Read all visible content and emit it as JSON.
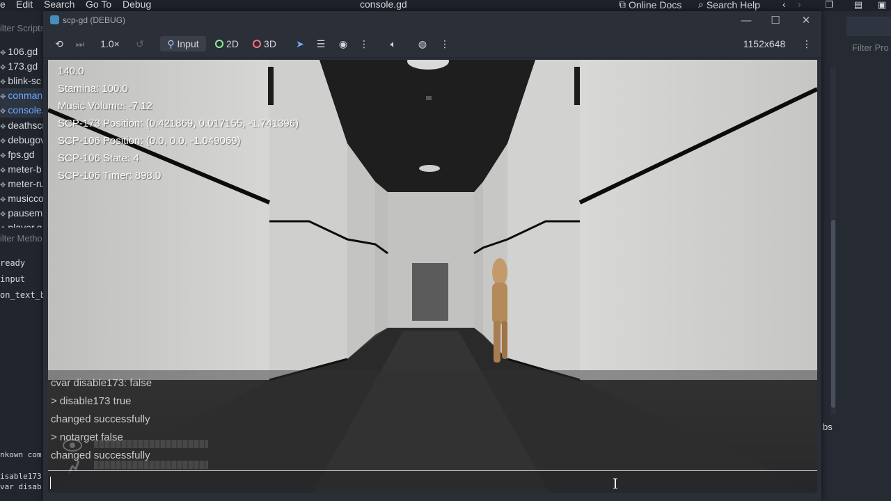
{
  "editor": {
    "menu": [
      "e",
      "Edit",
      "Search",
      "Go To",
      "Debug"
    ],
    "file_title": "console.gd",
    "online_docs": "Online Docs",
    "search_help": "Search Help",
    "filter_scripts": "ilter Scripts",
    "scripts": [
      "106.gd",
      "173.gd",
      "blink-sc",
      "conman.",
      "console.",
      "deathscr",
      "debugov",
      "fps.gd",
      "meter-b",
      "meter-ru",
      "musicco",
      "pauseme",
      "player.g"
    ],
    "filter_methods": "ilter Metho",
    "methods": [
      "ready",
      "input",
      "on_text_b"
    ],
    "output_lines": [
      "nkown com",
      "isable173",
      "var disab"
    ],
    "right_filter": "Filter Pro",
    "right_tab": "bs"
  },
  "window": {
    "title": "scp-gd (DEBUG)",
    "minimize": "—",
    "maximize": "☐",
    "close": "✕"
  },
  "toolbar": {
    "speed": "1.0×",
    "input": "Input",
    "mode_2d": "2D",
    "mode_3d": "3D",
    "resolution": "1152x648"
  },
  "hud": {
    "line1": "140.0",
    "stamina": "Stamina: 100.0",
    "music_volume": "Music Volume: -7.12",
    "scp173_position": "SCP-173 Position: (0.421869, 0.017155, -1.741396)",
    "scp106_position": "SCP-106 Position: (0.0, 0.0, -1.049069)",
    "scp106_state": "SCP-106 State: 4",
    "scp106_timer": "SCP-106 Timer: 898.0"
  },
  "console": {
    "lines": [
      "cvar disable173: false",
      "> disable173 true",
      "changed successfully",
      "> notarget false",
      "changed successfully"
    ],
    "input_value": ""
  },
  "colors": {
    "accent": "#6ea8ff",
    "editor_bg": "#1d2129",
    "wall": "#c9c9c7"
  }
}
